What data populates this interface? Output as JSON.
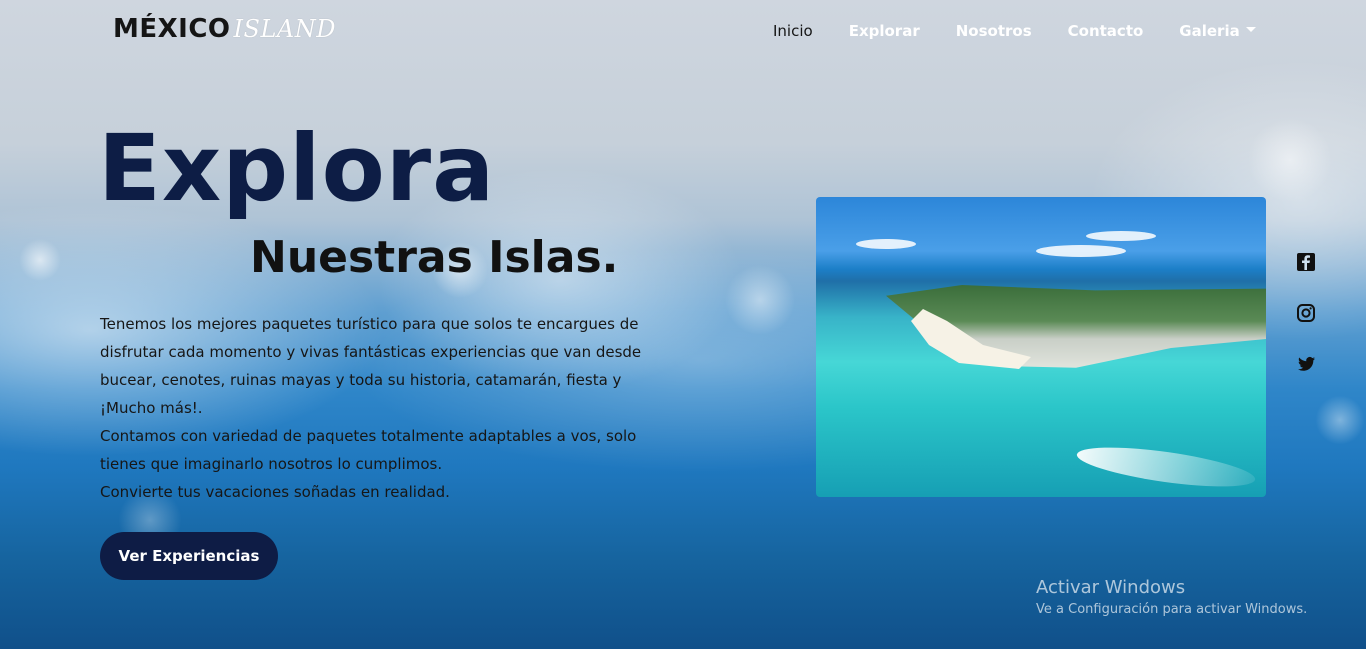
{
  "brand": {
    "part1": "MÉXICO",
    "part2": "ISLAND"
  },
  "nav": {
    "items": [
      {
        "label": "Inicio"
      },
      {
        "label": "Explorar"
      },
      {
        "label": "Nosotros"
      },
      {
        "label": "Contacto"
      },
      {
        "label": "Galeria"
      }
    ]
  },
  "hero": {
    "title": "Explora",
    "subtitle": "Nuestras Islas.",
    "paragraphs": [
      "Tenemos los mejores paquetes turístico para que solos te encargues de disfrutar cada momento  y vivas fantásticas experiencias que van desde bucear, cenotes, ruinas mayas y toda su historia, catamarán, fiesta y ¡Mucho más!.",
      "Contamos con variedad de paquetes totalmente adaptables a vos, solo tienes que imaginarlo nosotros lo cumplimos.",
      "Convierte tus vacaciones soñadas en realidad."
    ],
    "cta_label": "Ver Experiencias"
  },
  "social": {
    "icons": [
      "facebook-icon",
      "instagram-icon",
      "twitter-icon"
    ]
  },
  "watermark": {
    "title": "Activar Windows",
    "subtitle": "Ve a Configuración para activar Windows."
  },
  "colors": {
    "navy": "#0e1c45",
    "text_dark": "#151515",
    "white": "#ffffff"
  }
}
